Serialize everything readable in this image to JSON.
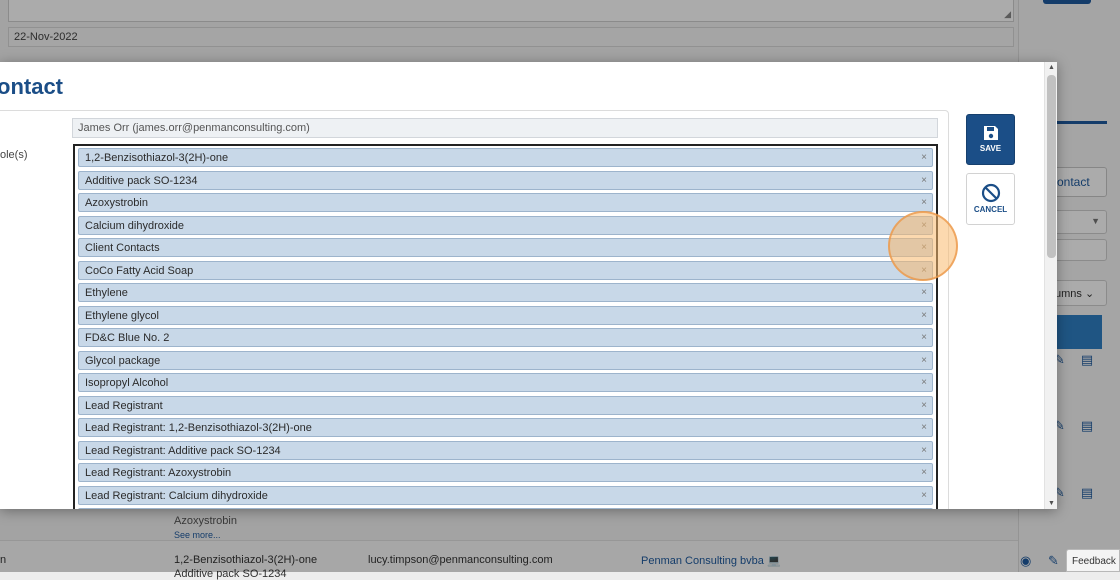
{
  "background": {
    "date_value": "22-Nov-2022",
    "contact_button_label": "ontact",
    "columns_button_label": "umns",
    "bottom_row": {
      "first_cell": "n",
      "item_name": "1,2-Benzisothiazol-3(2H)-one",
      "item_name_cont": "Additive pack SO-1234",
      "email": "lucy.timpson@penmanconsulting.com",
      "company": "Penman Consulting bvba"
    },
    "row_above": {
      "item": "Azoxystrobin",
      "see_more": "See more..."
    },
    "feedback_label": "Feedback"
  },
  "modal": {
    "title": "ontact",
    "roles_label": "ole(s)",
    "user_value": "James Orr (james.orr@penmanconsulting.com)",
    "tags": [
      "1,2-Benzisothiazol-3(2H)-one",
      "Additive pack SO-1234",
      "Azoxystrobin",
      "Calcium dihydroxide",
      "Client Contacts",
      "CoCo Fatty Acid Soap",
      "Ethylene",
      "Ethylene glycol",
      "FD&C Blue No. 2",
      "Glycol package",
      "Isopropyl Alcohol",
      "Lead Registrant",
      "Lead Registrant: 1,2-Benzisothiazol-3(2H)-one",
      "Lead Registrant: Additive pack SO-1234",
      "Lead Registrant: Azoxystrobin",
      "Lead Registrant: Calcium dihydroxide",
      ""
    ],
    "remove_glyph": "×",
    "save_label": "SAVE",
    "cancel_label": "CANCEL"
  },
  "colors": {
    "brand": "#1b4e87",
    "tag_bg": "#c8d8e8",
    "click_marker": "#f5a85a"
  }
}
